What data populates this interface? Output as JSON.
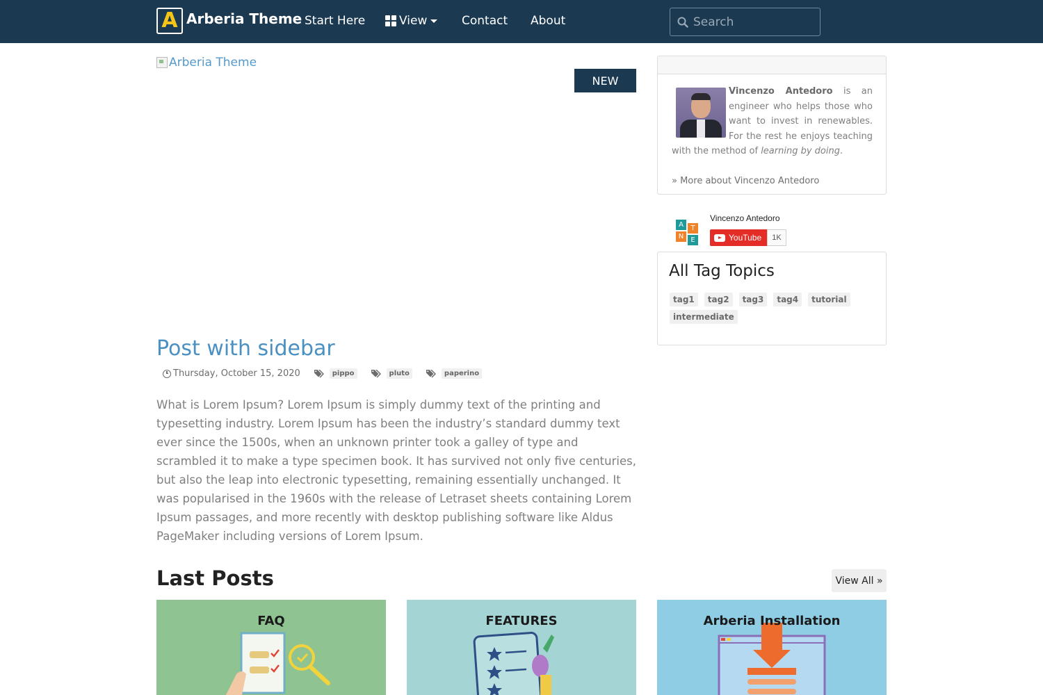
{
  "navbar": {
    "brand_letter": "A",
    "brand_name": "Arberia Theme",
    "links": [
      "Start Here",
      "View",
      "Contact",
      "About"
    ],
    "search_placeholder": "Search",
    "colors": {
      "background": "#1b3a52",
      "brand_accent": "#f5c518"
    }
  },
  "post": {
    "image_alt": "Arberia Theme",
    "badge": "NEW",
    "title": "Post with sidebar",
    "date": "Thursday, October 15, 2020",
    "tags": [
      "pippo",
      "pluto",
      "paperino"
    ],
    "excerpt": "What is Lorem Ipsum? Lorem Ipsum is simply dummy text of the printing and typesetting industry. Lorem Ipsum has been the industry’s standard dummy text ever since the 1500s, when an unknown printer took a galley of type and scrambled it to make a type specimen book. It has survived not only five centuries, but also the leap into electronic typesetting, remaining essentially unchanged. It was popularised in the 1960s with the release of Letraset sheets containing Lorem Ipsum passages, and more recently with desktop publishing software like Aldus PageMaker including versions of Lorem Ipsum."
  },
  "sidebar": {
    "author": {
      "name": "Vincenzo Antedoro",
      "bio_1": " is an engineer who helps those who want to invest in renewables. For the rest he enjoys teaching with the method of ",
      "bio_em": "learning by doing",
      "bio_end": ".",
      "more_link": "» More about Vincenzo Antedoro"
    },
    "youtube": {
      "logo_letters": [
        "A",
        "T",
        "N",
        "E"
      ],
      "channel_name": "Vincenzo Antedoro",
      "button_label": "YouTube",
      "subscriber_count": "1K"
    },
    "tag_topics": {
      "title": "All Tag Topics",
      "tags": [
        "tag1",
        "tag2",
        "tag3",
        "tag4",
        "tutorial",
        "intermediate"
      ]
    }
  },
  "last_posts": {
    "title": "Last Posts",
    "view_all": "View All »",
    "cards": [
      {
        "title": "FAQ",
        "color": "#8fc492"
      },
      {
        "title": "FEATURES",
        "color": "#a5d4d4"
      },
      {
        "title": "Arberia Installation",
        "color": "#8fcde4"
      }
    ]
  }
}
